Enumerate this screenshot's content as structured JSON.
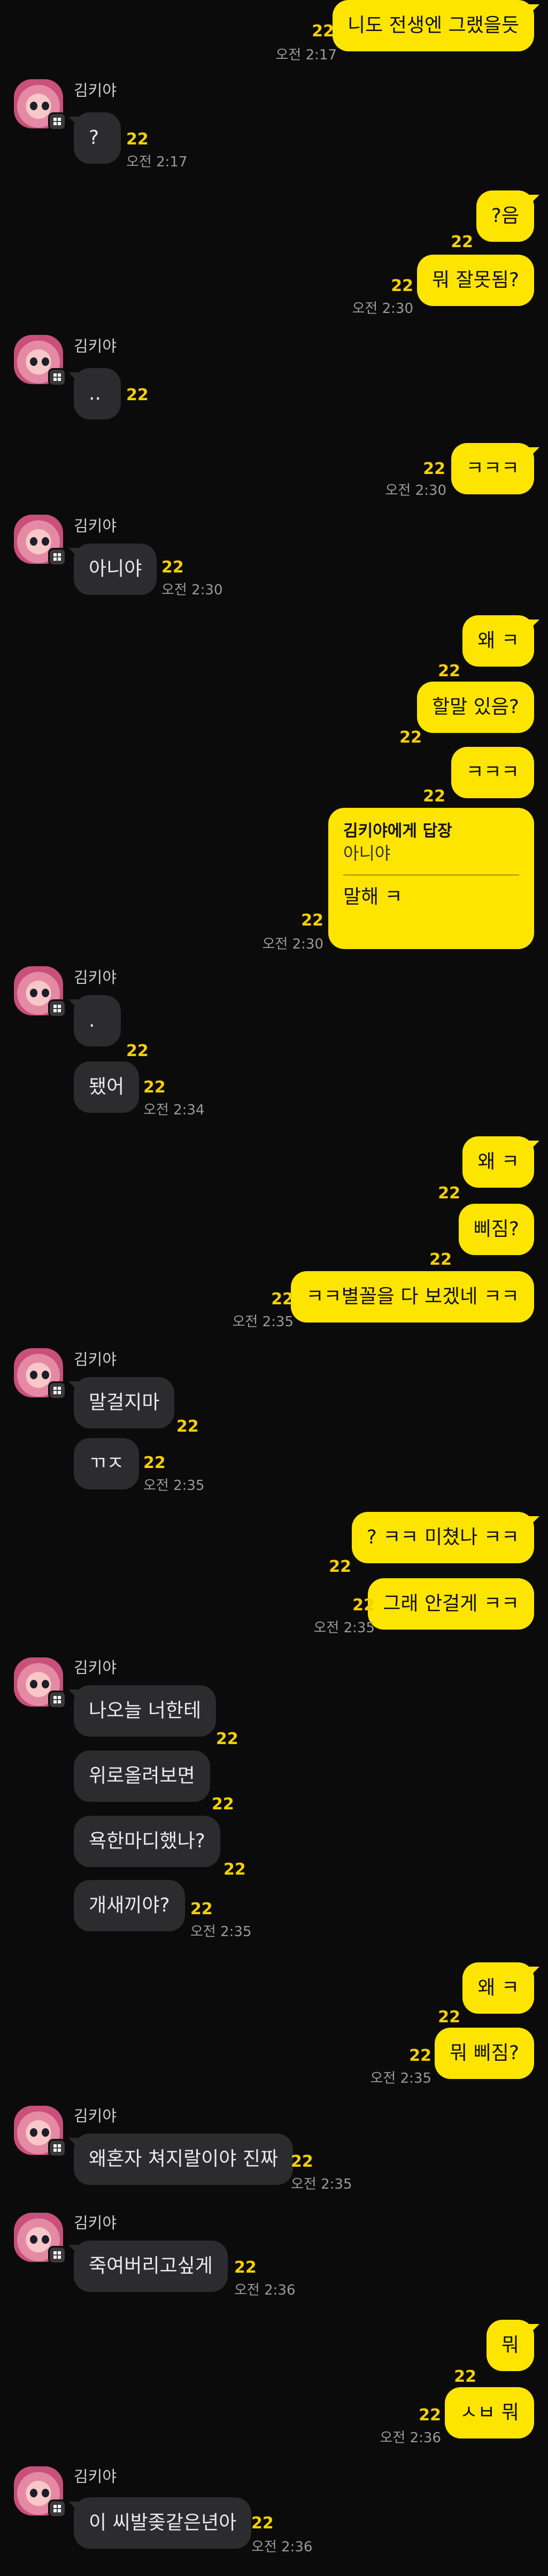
{
  "chat": {
    "partner_name": "김키야",
    "unread_label": "22",
    "messages": [
      {
        "text": "니도 전생엔 그랬을듯",
        "time": "오전 2:17"
      },
      {
        "text": "?",
        "time": "오전 2:17"
      },
      {
        "text": "?음"
      },
      {
        "text": "뭐 잘못됨?",
        "time": "오전 2:30"
      },
      {
        "text": ".."
      },
      {
        "text": "ㅋㅋㅋ",
        "time": "오전 2:30"
      },
      {
        "text": "아니야",
        "time": "오전 2:30"
      },
      {
        "text": "왜 ㅋ"
      },
      {
        "text": "할말 있음?"
      },
      {
        "text": "ㅋㅋㅋ"
      },
      {
        "reply_to_label": "김키야에게 답장",
        "quote": "아니야",
        "text": "말해 ㅋ",
        "time": "오전 2:30"
      },
      {
        "text": "."
      },
      {
        "text": "됐어",
        "time": "오전 2:34"
      },
      {
        "text": "왜 ㅋ"
      },
      {
        "text": "삐짐?"
      },
      {
        "text": "ㅋㅋ별꼴을 다 보겠네 ㅋㅋ",
        "time": "오전 2:35"
      },
      {
        "text": "말걸지마"
      },
      {
        "text": "ㄲㅈ",
        "time": "오전 2:35"
      },
      {
        "text": "? ㅋㅋ 미쳤나 ㅋㅋ"
      },
      {
        "text": "그래 안걸게 ㅋㅋ",
        "time": "오전 2:35"
      },
      {
        "text": "나오늘 너한테"
      },
      {
        "text": "위로올려보면"
      },
      {
        "text": "욕한마디했나?"
      },
      {
        "text": "개새끼야?",
        "time": "오전 2:35"
      },
      {
        "text": "왜 ㅋ"
      },
      {
        "text": "뭐 삐짐?",
        "time": "오전 2:35"
      },
      {
        "text": "왜혼자 쳐지랄이야 진짜",
        "time": "오전 2:35"
      },
      {
        "text": "죽여버리고싶게",
        "time": "오전 2:36"
      },
      {
        "text": "뭐"
      },
      {
        "text": "ㅅㅂ 뭐",
        "time": "오전 2:36"
      },
      {
        "text": "이 씨발좆같은년아",
        "time": "오전 2:36"
      }
    ]
  },
  "colors": {
    "my_bubble": "#fee500",
    "their_bubble": "#2c2c2e",
    "unread": "#f5d000",
    "background": "#0b0b0b"
  }
}
